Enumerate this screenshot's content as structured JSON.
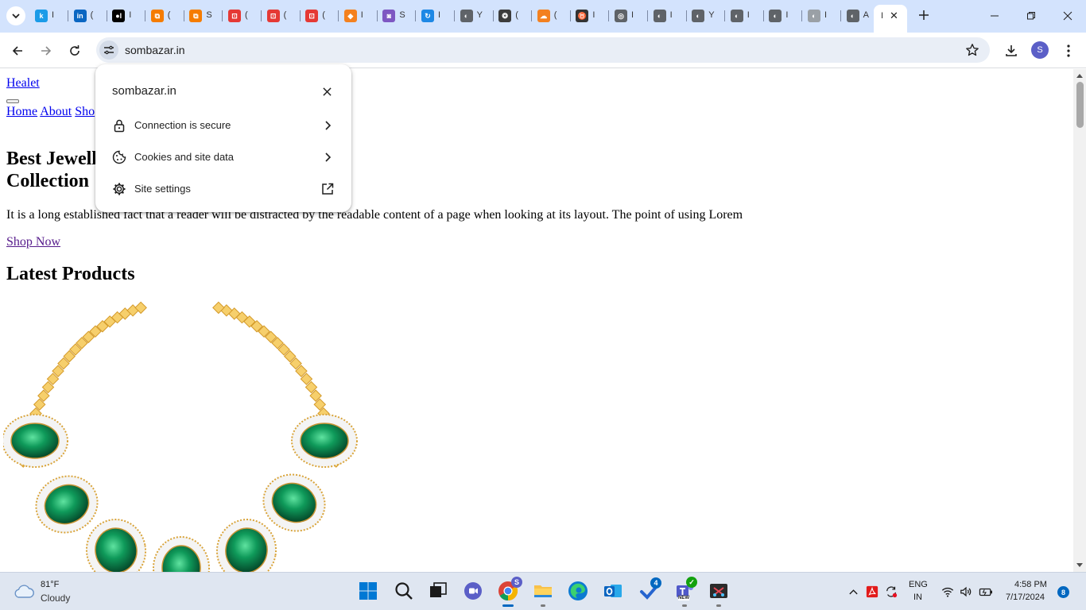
{
  "browser": {
    "tabs": [
      {
        "icon": "k-icon",
        "glyph": "k",
        "color": "#1a9be8",
        "frag": "I"
      },
      {
        "icon": "linkedin-icon",
        "glyph": "in",
        "color": "#0a66c2",
        "frag": "("
      },
      {
        "icon": "medium-icon",
        "glyph": "●I",
        "color": "#000000",
        "frag": "I"
      },
      {
        "icon": "blogger-icon",
        "glyph": "⧉",
        "color": "#f57c00",
        "frag": "("
      },
      {
        "icon": "blogger-icon",
        "glyph": "⧉",
        "color": "#f57c00",
        "frag": "S"
      },
      {
        "icon": "pdf-tool-icon",
        "glyph": "⊡",
        "color": "#e53935",
        "frag": "("
      },
      {
        "icon": "pdf-tool-icon",
        "glyph": "⊡",
        "color": "#e53935",
        "frag": "("
      },
      {
        "icon": "pdf-tool-icon",
        "glyph": "⊡",
        "color": "#e53935",
        "frag": "("
      },
      {
        "icon": "cube-icon",
        "glyph": "◆",
        "color": "#f4811f",
        "frag": "I"
      },
      {
        "icon": "shield-app-icon",
        "glyph": "◙",
        "color": "#7e57c2",
        "frag": "S"
      },
      {
        "icon": "sync-icon",
        "glyph": "↻",
        "color": "#1e88e5",
        "frag": "I"
      },
      {
        "icon": "globe-icon",
        "glyph": "◐",
        "color": "#5f6368",
        "frag": "Y"
      },
      {
        "icon": "openai-icon",
        "glyph": "❂",
        "color": "#3c3c3c",
        "frag": "("
      },
      {
        "icon": "cloudflare-icon",
        "glyph": "☁",
        "color": "#f38020",
        "frag": "("
      },
      {
        "icon": "pendant-icon",
        "glyph": "♉",
        "color": "#333333",
        "frag": "I"
      },
      {
        "icon": "chrome-icon",
        "glyph": "◎",
        "color": "#5f6368",
        "frag": "I"
      },
      {
        "icon": "globe-icon",
        "glyph": "◐",
        "color": "#5f6368",
        "frag": "I"
      },
      {
        "icon": "globe-icon",
        "glyph": "◐",
        "color": "#5f6368",
        "frag": "Y"
      },
      {
        "icon": "globe-icon",
        "glyph": "◐",
        "color": "#5f6368",
        "frag": "I"
      },
      {
        "icon": "globe-icon",
        "glyph": "◐",
        "color": "#5f6368",
        "frag": "I"
      },
      {
        "icon": "globe-icon",
        "glyph": "◐",
        "color": "#9aa0a6",
        "frag": "I"
      },
      {
        "icon": "globe-icon",
        "glyph": "◐",
        "color": "#5f6368",
        "frag": "A"
      }
    ],
    "active_tab_frag": "I",
    "url": "sombazar.in",
    "profile_initial": "S"
  },
  "page": {
    "brand": "Healet",
    "nav": [
      "Home",
      "About",
      "Sho"
    ],
    "hero_title_line1": "Best Jewell",
    "hero_title_line2": "Collection",
    "hero_text": "It is a long established fact that a reader will be distracted by the readable content of a page when looking at its layout. The point of using Lorem",
    "shop_now": "Shop Now",
    "latest_heading": "Latest Products"
  },
  "site_info_popup": {
    "title": "sombazar.in",
    "items": [
      {
        "label": "Connection is secure",
        "icon": "lock-icon",
        "end_icon": "chevron-right-icon"
      },
      {
        "label": "Cookies and site data",
        "icon": "cookie-icon",
        "end_icon": "chevron-right-icon"
      },
      {
        "label": "Site settings",
        "icon": "gear-icon",
        "end_icon": "external-link-icon"
      }
    ]
  },
  "taskbar": {
    "weather_temp": "81°F",
    "weather_condition": "Cloudy",
    "chrome_badge": "S",
    "todo_badge": "4",
    "teams_label": "NEW",
    "language_line1": "ENG",
    "language_line2": "IN",
    "time": "4:58 PM",
    "date": "7/17/2024",
    "notification_count": "8"
  }
}
